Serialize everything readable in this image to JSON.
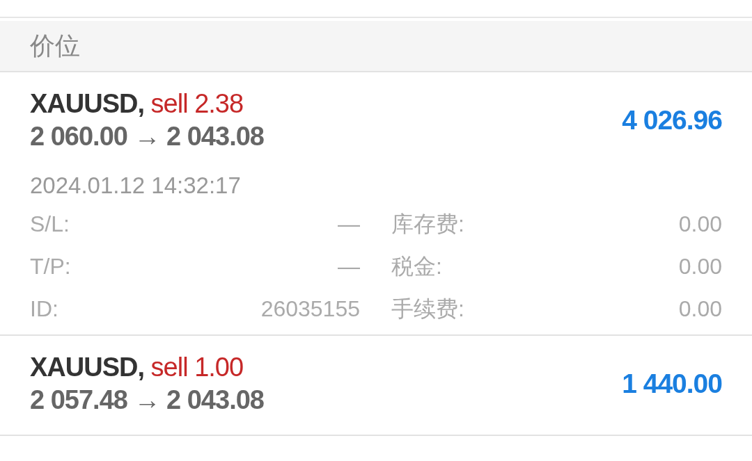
{
  "section_header": "价位",
  "positions": [
    {
      "symbol": "XAUUSD,",
      "trade": "sell 2.38",
      "open_price": "2 060.00",
      "arrow": "→",
      "current_price": "2 043.08",
      "profit": "4 026.96",
      "expanded": true,
      "time": "2024.01.12 14:32:17",
      "details": [
        {
          "left_label": "S/L:",
          "left_value": "—",
          "right_label": "库存费:",
          "right_value": "0.00"
        },
        {
          "left_label": "T/P:",
          "left_value": "—",
          "right_label": "税金:",
          "right_value": "0.00"
        },
        {
          "left_label": "ID:",
          "left_value": "26035155",
          "right_label": "手续费:",
          "right_value": "0.00"
        }
      ]
    },
    {
      "symbol": "XAUUSD,",
      "trade": "sell 1.00",
      "open_price": "2 057.48",
      "arrow": "→",
      "current_price": "2 043.08",
      "profit": "1 440.00",
      "expanded": false
    }
  ]
}
